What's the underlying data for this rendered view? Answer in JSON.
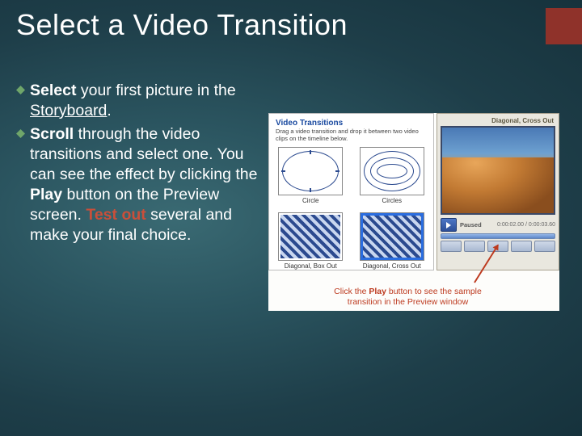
{
  "title": "Select a Video Transition",
  "bullets": [
    {
      "runs": [
        {
          "t": "Select",
          "bold": true
        },
        {
          "t": " your first picture in the "
        },
        {
          "t": "Storyboard",
          "underline": true
        },
        {
          "t": "."
        }
      ]
    },
    {
      "runs": [
        {
          "t": "Scroll",
          "bold": true
        },
        {
          "t": " through the video transitions and select one. You can see the effect by clicking the "
        },
        {
          "t": "Play",
          "bold": true
        },
        {
          "t": " button on the Preview screen. "
        },
        {
          "t": "Test out",
          "red": true,
          "bold": true
        },
        {
          "t": " several and make your final choice."
        }
      ]
    }
  ],
  "transitionsPanel": {
    "title": "Video Transitions",
    "subtitle": "Drag a video transition and drop it between two video clips on the timeline below.",
    "items": [
      {
        "label": "Circle"
      },
      {
        "label": "Circles"
      },
      {
        "label": "Diagonal, Box Out"
      },
      {
        "label": "Diagonal, Cross Out"
      }
    ]
  },
  "preview": {
    "caption": "Diagonal, Cross Out",
    "status": "Paused",
    "time": "0:00:02.00 / 0:00:03.60"
  },
  "figCaption": {
    "line1_a": "Click the ",
    "line1_b": "Play",
    "line1_c": " button to see the sample",
    "line2": "transition in the Preview window"
  }
}
